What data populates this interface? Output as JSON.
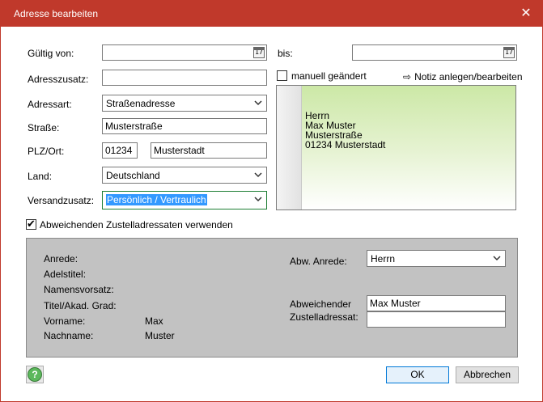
{
  "window": {
    "title": "Adresse bearbeiten",
    "close_label": "✕"
  },
  "form": {
    "valid_from_label": "Gültig von:",
    "valid_from_value": "",
    "valid_to_label": "bis:",
    "valid_to_value": "",
    "calendar_icon_text": "17",
    "address_suffix_label": "Adresszusatz:",
    "address_suffix_value": "",
    "address_type_label": "Adressart:",
    "address_type_value": "Straßenadresse",
    "street_label": "Straße:",
    "street_value": "Musterstraße",
    "zip_city_label": "PLZ/Ort:",
    "zip_value": "01234",
    "city_value": "Musterstadt",
    "country_label": "Land:",
    "country_value": "Deutschland",
    "shipping_label": "Versandzusatz:",
    "shipping_value": "Persönlich / Vertraulich",
    "manually_changed_label": "manuell geändert",
    "manually_changed_checked": false,
    "note_arrow": "⇨",
    "note_link": "Notiz anlegen/bearbeiten",
    "use_alt_recipient_label": "Abweichenden Zustelladressaten verwenden",
    "use_alt_recipient_checked": true
  },
  "preview": {
    "lines": [
      "Herrn",
      "Max Muster",
      "Musterstraße",
      "01234 Musterstadt"
    ]
  },
  "recipient": {
    "salutation_label": "Anrede:",
    "title_label": "Adelstitel:",
    "prefix_label": "Namensvorsatz:",
    "academic_label": "Titel/Akad. Grad:",
    "firstname_label": "Vorname:",
    "firstname_value": "Max",
    "lastname_label": "Nachname:",
    "lastname_value": "Muster",
    "alt_salutation_label": "Abw. Anrede:",
    "alt_salutation_value": "Herrn",
    "alt_recipient_label_1": "Abweichender",
    "alt_recipient_label_2": "Zustelladressat:",
    "alt_recipient_line1": "Max Muster",
    "alt_recipient_line2": ""
  },
  "footer": {
    "help_icon_text": "?",
    "ok_label": "OK",
    "cancel_label": "Abbrechen"
  },
  "colors": {
    "titlebar": "#c0392b",
    "selection": "#3399ff",
    "panel": "#c2c2c2",
    "preview_gradient_top": "#cce8a6"
  }
}
